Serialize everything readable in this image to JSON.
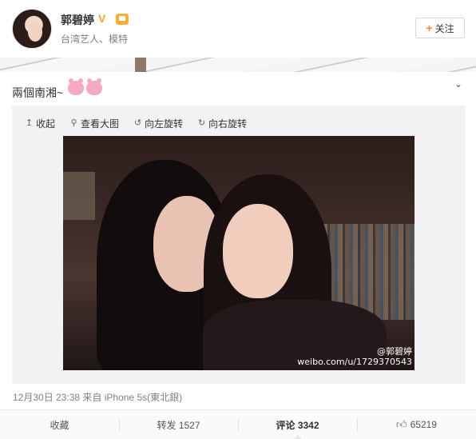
{
  "profile": {
    "username": "郭碧婷",
    "verified_mark": "V",
    "subtitle": "台湾艺人、模特",
    "follow_label": "关注",
    "follow_icon": "plus-icon"
  },
  "post": {
    "text": "兩個南湘~",
    "emoji_icons": [
      "pink-bunny-emoji",
      "pink-bunny-emoji"
    ],
    "expand_icon": "chevron-down-icon"
  },
  "media_toolbar": {
    "collapse_label": "收起",
    "view_large_label": "查看大图",
    "rotate_left_label": "向左旋转",
    "rotate_right_label": "向右旋转"
  },
  "photo": {
    "watermark_user": "@郭碧婷",
    "watermark_url": "weibo.com/u/1729370543"
  },
  "meta": {
    "timestamp": "12月30日 23:38",
    "source": "来自 iPhone 5s(東北銀)"
  },
  "actions": {
    "favorite_label": "收藏",
    "repost_label": "转发 1527",
    "comment_label": "评论 3342",
    "like_count": "65219",
    "like_icon": "thumbs-up-icon"
  },
  "colors": {
    "accent_orange": "#ff8140",
    "verified_gold": "#f5a623",
    "muted_text": "#808080"
  }
}
